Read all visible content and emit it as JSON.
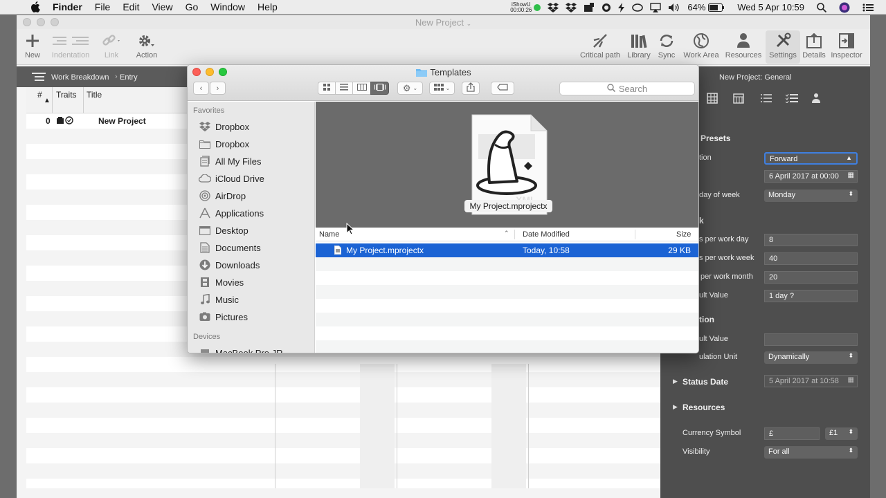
{
  "menubar": {
    "app_name": "Finder",
    "menus": [
      "File",
      "Edit",
      "View",
      "Go",
      "Window",
      "Help"
    ],
    "ishowu_label": "iShowU",
    "ishowu_time": "00:00:26",
    "battery": "64%",
    "clock": "Wed 5 Apr  10:59"
  },
  "app": {
    "title": "New Project",
    "toolbar_left": [
      "New",
      "Indentation",
      "Link",
      "Action"
    ],
    "toolbar_right": [
      "Critical path",
      "Library",
      "Sync",
      "Work Area",
      "Resources",
      "Settings",
      "Details",
      "Inspector"
    ],
    "breadcrumb": [
      "Work Breakdown",
      "Entry"
    ],
    "outline_columns": [
      "#",
      "Traits",
      "Title"
    ],
    "outline_rows": [
      {
        "num": "0",
        "title": "New Project"
      }
    ]
  },
  "inspector": {
    "header": "New Project: General",
    "presets_title": "Presets",
    "rows": [
      {
        "label": "tion",
        "value": "Forward",
        "kind": "select"
      },
      {
        "label": "",
        "value": "6 April 2017 at 00:00",
        "kind": "date"
      },
      {
        "label": "day of week",
        "value": "Monday",
        "kind": "select"
      },
      {
        "label": "s per work day",
        "value": "8",
        "kind": "field"
      },
      {
        "label": "s per work week",
        "value": "40",
        "kind": "field"
      },
      {
        "label": "per work month",
        "value": "20",
        "kind": "field"
      },
      {
        "label": "ult Value",
        "value": "1 day ?",
        "kind": "field"
      },
      {
        "label": "ult Value",
        "value": "",
        "kind": "field"
      },
      {
        "label": "ulation Unit",
        "value": "Dynamically",
        "kind": "select"
      }
    ],
    "k_label": "k",
    "tion_label": "tion",
    "status_date_label": "Status Date",
    "status_date_value": "5 April 2017 at 10:58",
    "resources_label": "Resources",
    "currency_label": "Currency Symbol",
    "currency_value": "£",
    "currency_select": "£1",
    "visibility_label": "Visibility",
    "visibility_value": "For all"
  },
  "finder": {
    "title": "Templates",
    "search_placeholder": "Search",
    "favorites_heading": "Favorites",
    "favorites": [
      {
        "label": "Dropbox",
        "icon": "dropbox-icon"
      },
      {
        "label": "Dropbox",
        "icon": "folder-icon"
      },
      {
        "label": "All My Files",
        "icon": "all-files-icon"
      },
      {
        "label": "iCloud Drive",
        "icon": "cloud-icon"
      },
      {
        "label": "AirDrop",
        "icon": "airdrop-icon"
      },
      {
        "label": "Applications",
        "icon": "applications-icon"
      },
      {
        "label": "Desktop",
        "icon": "desktop-icon"
      },
      {
        "label": "Documents",
        "icon": "documents-icon"
      },
      {
        "label": "Downloads",
        "icon": "downloads-icon"
      },
      {
        "label": "Movies",
        "icon": "movies-icon"
      },
      {
        "label": "Music",
        "icon": "music-icon"
      },
      {
        "label": "Pictures",
        "icon": "pictures-icon"
      }
    ],
    "devices_heading": "Devices",
    "devices": [
      {
        "label": "MacBook Pro JR",
        "icon": "laptop-icon"
      }
    ],
    "preview_label": "My Project.mprojectx",
    "columns": [
      "Name",
      "Date Modified",
      "Size"
    ],
    "files": [
      {
        "name": "My Project.mprojectx",
        "modified": "Today, 10:58",
        "size": "29 KB",
        "selected": true
      }
    ]
  }
}
